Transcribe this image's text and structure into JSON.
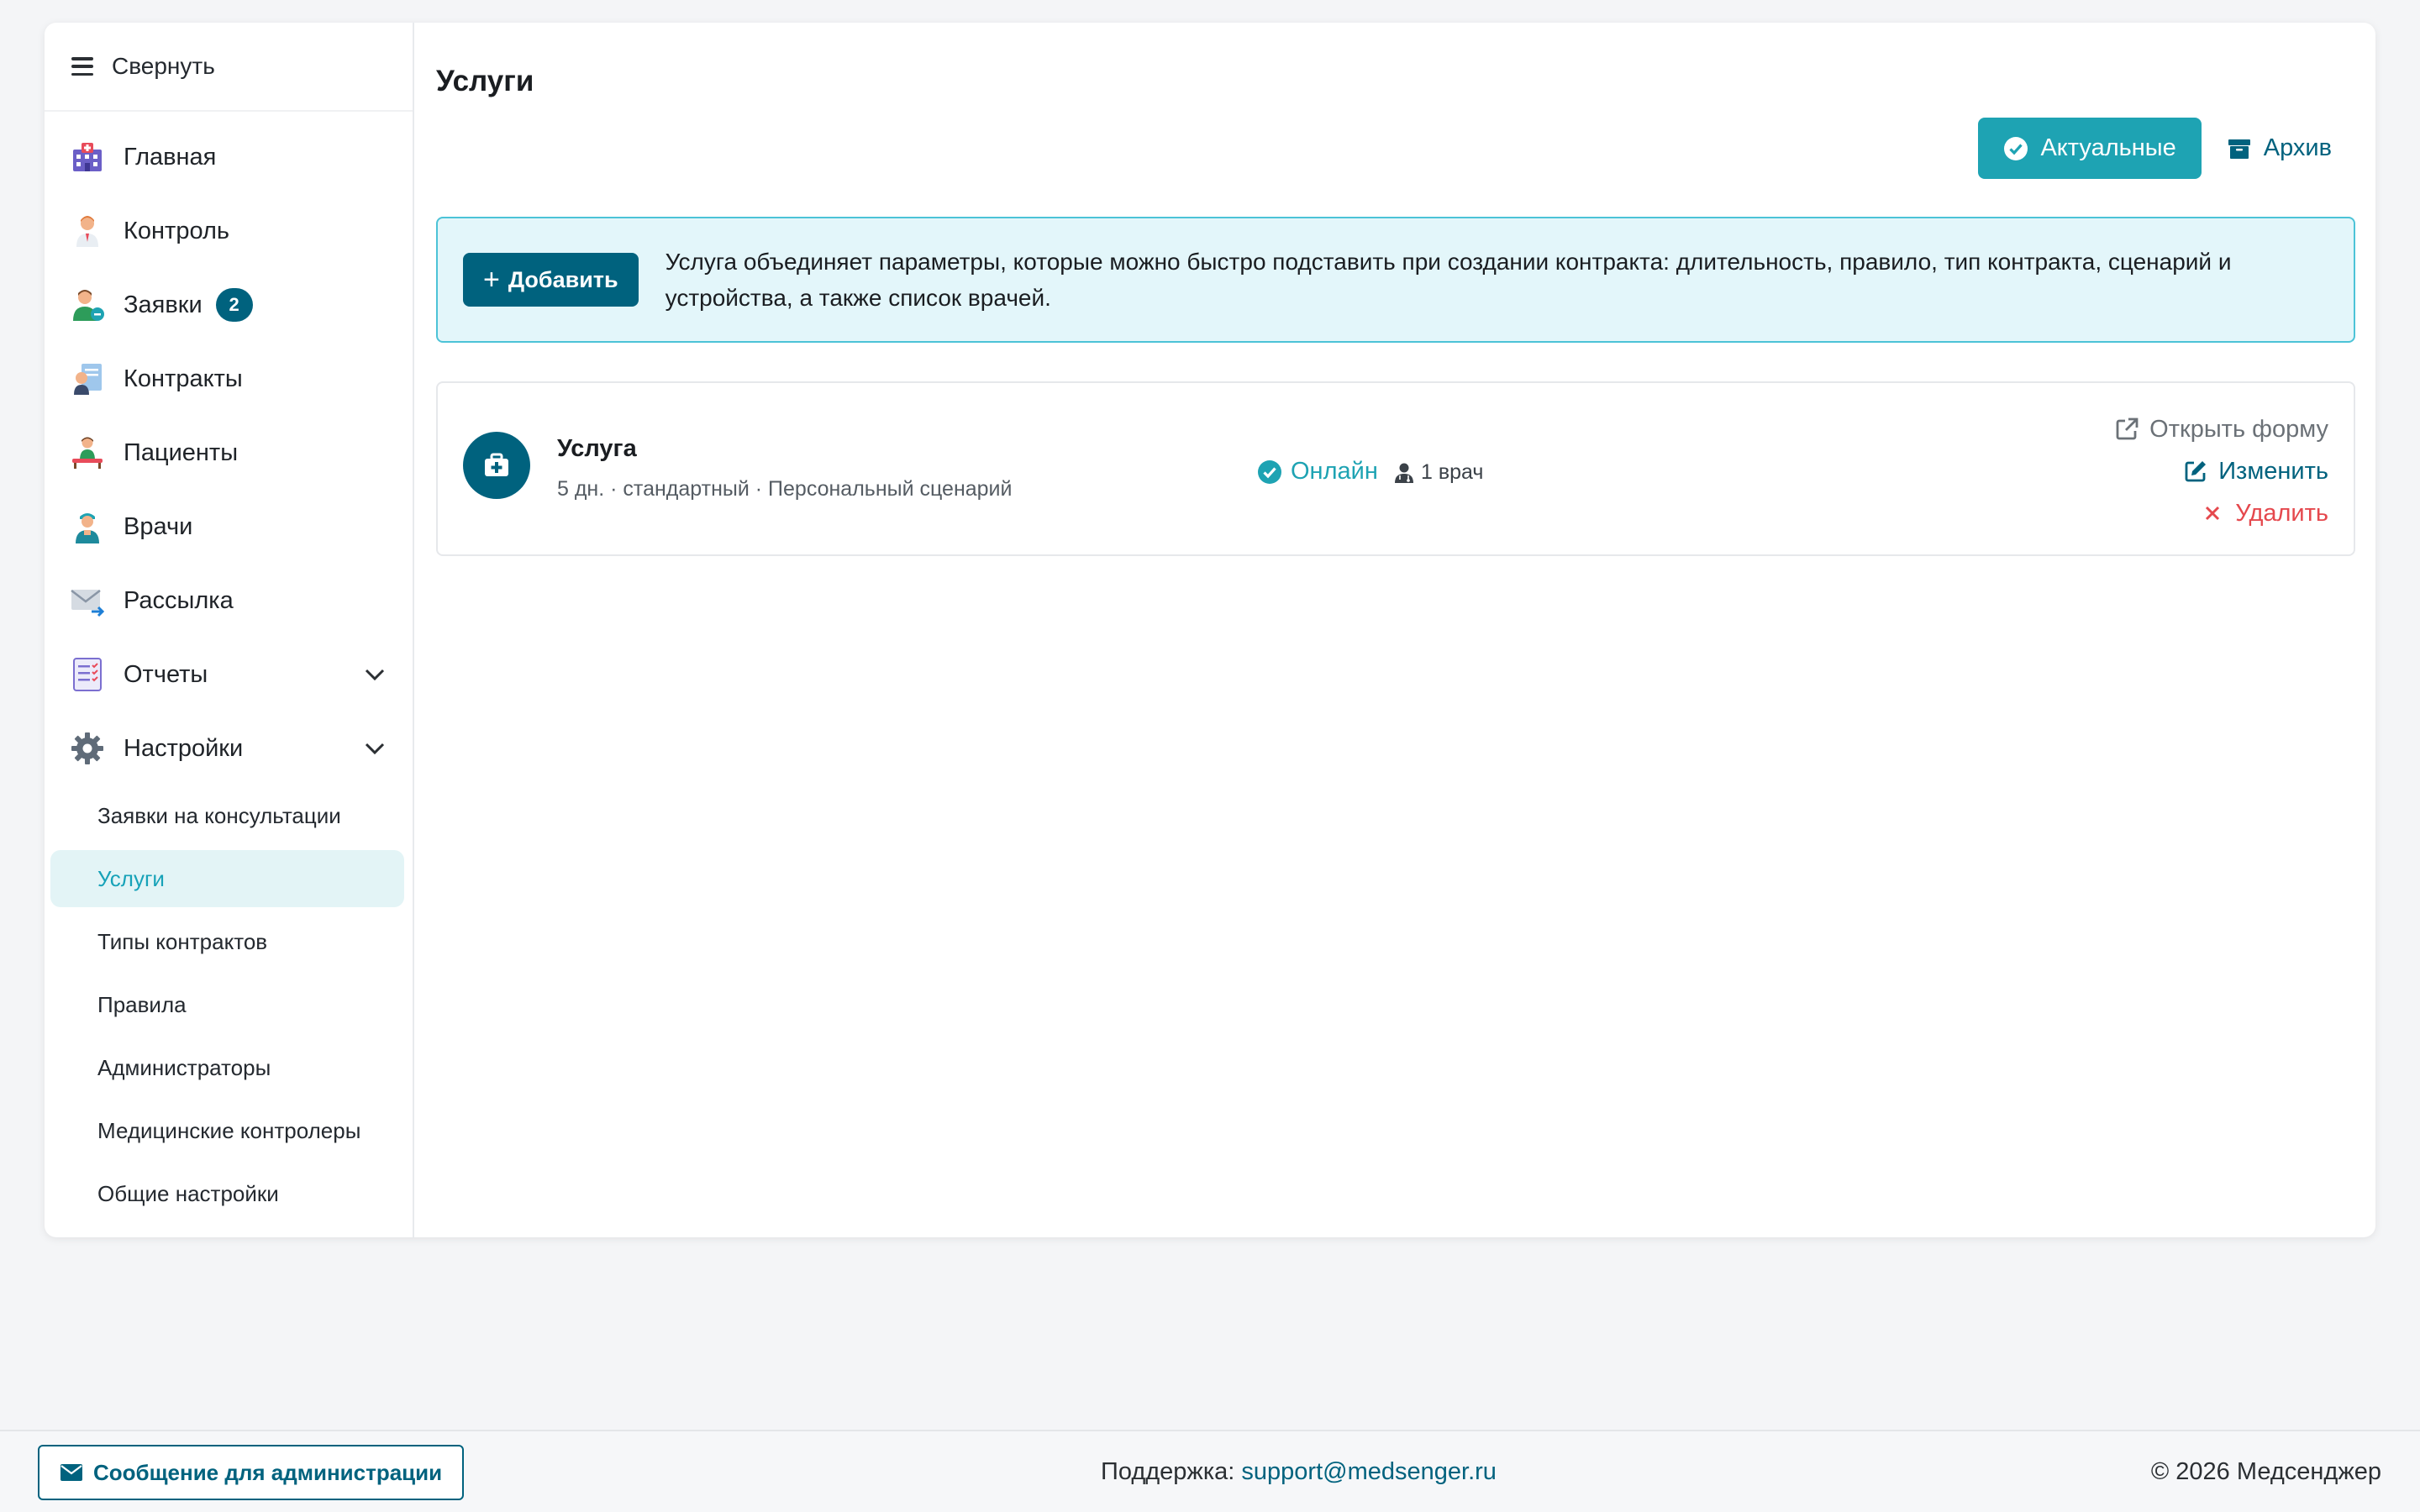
{
  "sidebar": {
    "collapse_label": "Свернуть",
    "items": [
      {
        "label": "Главная",
        "icon": "hospital-icon"
      },
      {
        "label": "Контроль",
        "icon": "doctor-icon"
      },
      {
        "label": "Заявки",
        "icon": "requests-icon",
        "badge": "2"
      },
      {
        "label": "Контракты",
        "icon": "contracts-icon"
      },
      {
        "label": "Пациенты",
        "icon": "patients-icon"
      },
      {
        "label": "Врачи",
        "icon": "physician-icon"
      },
      {
        "label": "Рассылка",
        "icon": "mail-icon"
      },
      {
        "label": "Отчеты",
        "icon": "reports-icon"
      },
      {
        "label": "Настройки",
        "icon": "gear-icon"
      }
    ],
    "settings_sub": [
      {
        "label": "Заявки на консультации"
      },
      {
        "label": "Услуги",
        "active": true
      },
      {
        "label": "Типы контрактов"
      },
      {
        "label": "Правила"
      },
      {
        "label": "Администраторы"
      },
      {
        "label": "Медицинские контролеры"
      },
      {
        "label": "Общие настройки"
      }
    ]
  },
  "main": {
    "title": "Услуги",
    "filters": {
      "actual": "Актуальные",
      "archive": "Архив"
    },
    "info": {
      "add_label": "Добавить",
      "text": "Услуга объединяет параметры, которые можно быстро подставить при создании контракта: длительность, правило, тип контракта, сценарий и устройства, а также список врачей."
    },
    "services": [
      {
        "name": "Услуга",
        "meta": "5 дн. · стандартный · Персональный сценарий",
        "status": "Онлайн",
        "doctors": "1 врач",
        "actions": {
          "open": "Открыть форму",
          "edit": "Изменить",
          "delete": "Удалить"
        }
      }
    ]
  },
  "footer": {
    "message_button": "Сообщение для администрации",
    "support_label": "Поддержка:",
    "support_email": "support@medsenger.ru",
    "copyright": "© 2026 Медсенджер"
  },
  "colors": {
    "primary": "#00627e",
    "accent": "#1ea3b3",
    "danger": "#e5484d",
    "info_bg": "#e3f6fa"
  }
}
